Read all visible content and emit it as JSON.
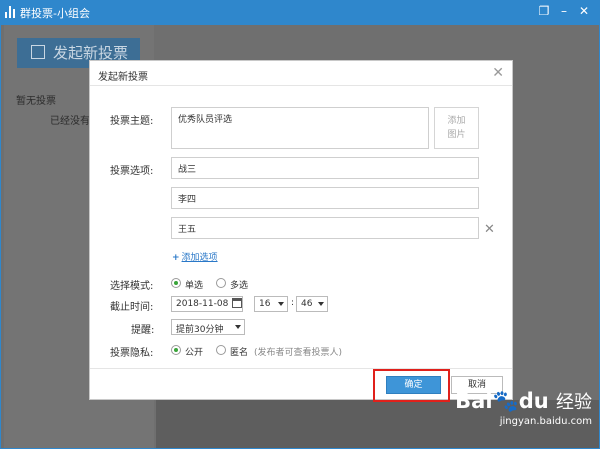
{
  "window": {
    "title": "群投票-小组会"
  },
  "app": {
    "new_vote_label": "发起新投票",
    "no_vote_text": "暂无投票",
    "no_more_text": "已经没有"
  },
  "dialog": {
    "title": "发起新投票",
    "subject_label": "投票主题:",
    "subject_value": "优秀队员评选",
    "add_image_line1": "添加",
    "add_image_line2": "图片",
    "options_label": "投票选项:",
    "options": [
      "战三",
      "李四",
      "王五"
    ],
    "add_option_label": "添加选项",
    "mode_label": "选择模式:",
    "mode_single": "单选",
    "mode_multi": "多选",
    "deadline_label": "截止时间:",
    "deadline_date": "2018-11-08",
    "deadline_hour": "16",
    "deadline_minute": "46",
    "reminder_label": "提醒:",
    "reminder_value": "提前30分钟",
    "privacy_label": "投票隐私:",
    "privacy_public": "公开",
    "privacy_anonymous": "匿名",
    "privacy_hint": "(发布者可查看投票人)",
    "ok_label": "确定",
    "cancel_label": "取消"
  },
  "watermark": {
    "brand": "Bai",
    "brand2": "du",
    "brand_cn": "经验",
    "url": "jingyan.baidu.com"
  },
  "colors": {
    "accent": "#3e95d8",
    "titlebar": "#2f87cc",
    "highlight": "#e0201b"
  }
}
